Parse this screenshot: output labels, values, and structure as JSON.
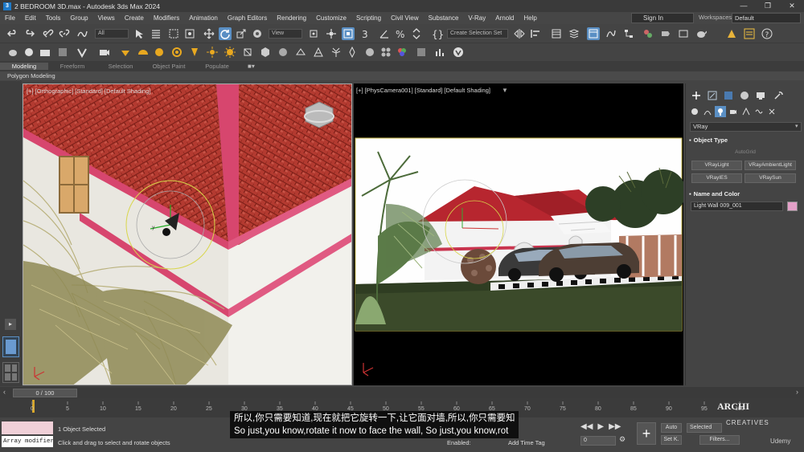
{
  "titlebar": {
    "title": "2 BEDROOM 3D.max - Autodesk 3ds Max 2024",
    "app_icon": "3"
  },
  "window_buttons": [
    "—",
    "❐",
    "✕"
  ],
  "menu": [
    "File",
    "Edit",
    "Tools",
    "Group",
    "Views",
    "Create",
    "Modifiers",
    "Animation",
    "Graph Editors",
    "Rendering",
    "Customize",
    "Scripting",
    "Civil View",
    "Substance",
    "V-Ray",
    "Arnold",
    "Help"
  ],
  "signin": "Sign In",
  "workspaces": {
    "label": "Workspaces:",
    "value": "Default"
  },
  "toolbar": {
    "selection_filter": "All",
    "ref_coord": "View",
    "selection_set": "Create Selection Set"
  },
  "ribbon": {
    "tabs": [
      "Modeling",
      "Freeform",
      "Selection",
      "Object Paint",
      "Populate"
    ],
    "active": "Modeling",
    "sub": "Polygon Modeling"
  },
  "viewport_left": {
    "label": "[+] [Orthographic] [Standard] [Default Shading]"
  },
  "viewport_right": {
    "label": "[+] [PhysCamera001] [Standard] [Default Shading]"
  },
  "command_panel": {
    "category": "VRay",
    "object_type_title": "Object Type",
    "autogrid": "AutoGrid",
    "buttons": [
      "VRayLight",
      "VRayAmbientLight",
      "VRayIES",
      "VRaySun"
    ],
    "name_color_title": "Name and Color",
    "name": "Light Wall 009_001",
    "swatch_color": "#e4a0c8"
  },
  "timeslider": {
    "frame": "0 / 100"
  },
  "trackbar_ticks": [
    "0",
    "5",
    "10",
    "15",
    "20",
    "25",
    "30",
    "35",
    "40",
    "45",
    "50",
    "55",
    "60",
    "65",
    "70",
    "75",
    "80",
    "85",
    "90",
    "95",
    "100"
  ],
  "status": {
    "array_modifier": "Array modifier",
    "selected": "1 Object Selected",
    "hint": "Click and drag to select and rotate objects",
    "enabled": "Enabled:",
    "add_time_tag": "Add Time Tag",
    "auto_key": "Auto",
    "set_key": "Set K.",
    "selected_mode": "Selected",
    "filters": "Filters...",
    "frame_field": "0"
  },
  "subtitle": {
    "zh": "所以,你只需要知道,现在就把它旋转一下,让它面对墙,所以,你只需要知",
    "en": "So just,you know,rotate it now to face the wall, So just,you know,rot"
  },
  "branding": {
    "logo": "ARCHI",
    "logo_sub": "CREATIVES",
    "udemy": "Udemy"
  }
}
